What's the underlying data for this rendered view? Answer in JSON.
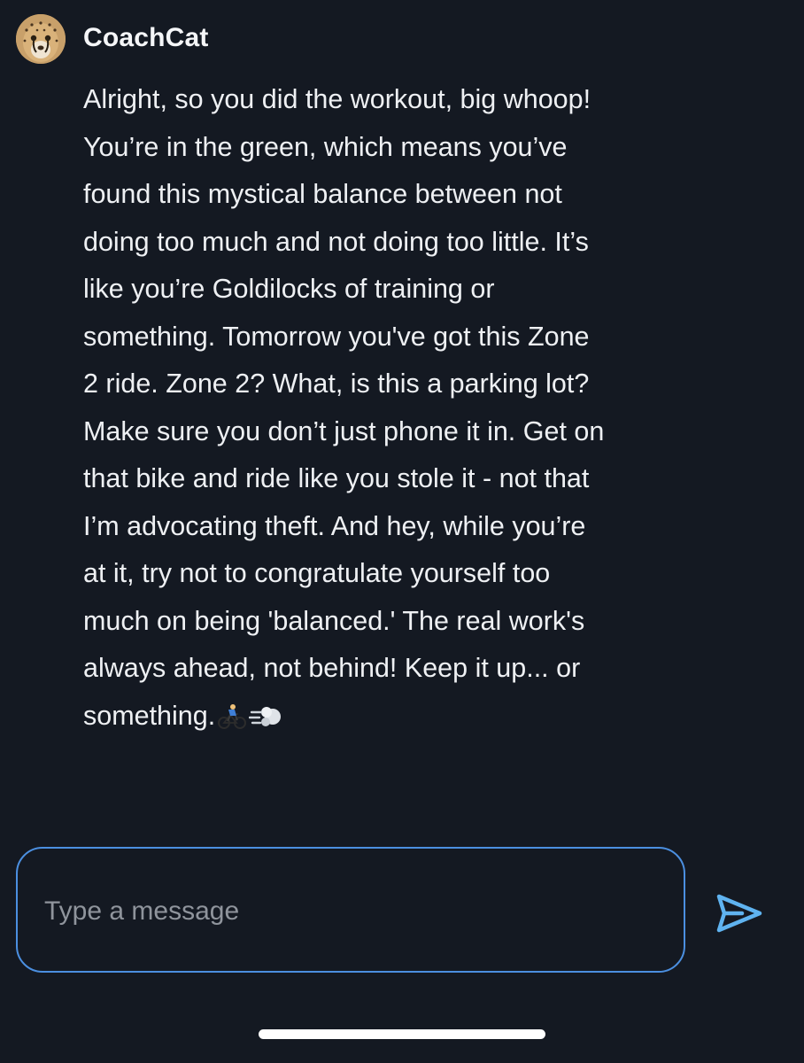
{
  "message": {
    "sender": "CoachCat",
    "avatar_icon": "cheetah-avatar-icon",
    "text": "Alright, so you did the workout, big whoop!\nYou’re in the green, which means you’ve\nfound this mystical balance between not\ndoing too much and not doing too little. It’s\nlike you’re Goldilocks of training or\nsomething. Tomorrow you've got this Zone\n2 ride. Zone 2? What, is this a parking lot?\nMake sure you don’t just phone it in. Get on\nthat bike and ride like you stole it - not that\nI’m advocating theft. And hey, while you’re\nat it, try not to congratulate yourself too\nmuch on being 'balanced.' The real work's\nalways ahead, not behind! Keep it up... or\nsomething.",
    "emoji_icons": [
      "cyclist-icon",
      "dash-icon"
    ]
  },
  "composer": {
    "placeholder": "Type a message",
    "value": "",
    "send_icon": "send-icon"
  },
  "colors": {
    "background": "#141922",
    "accent": "#4b8fe0",
    "send": "#5fb3f0",
    "text": "#eef0f3",
    "placeholder": "#8f949c"
  }
}
